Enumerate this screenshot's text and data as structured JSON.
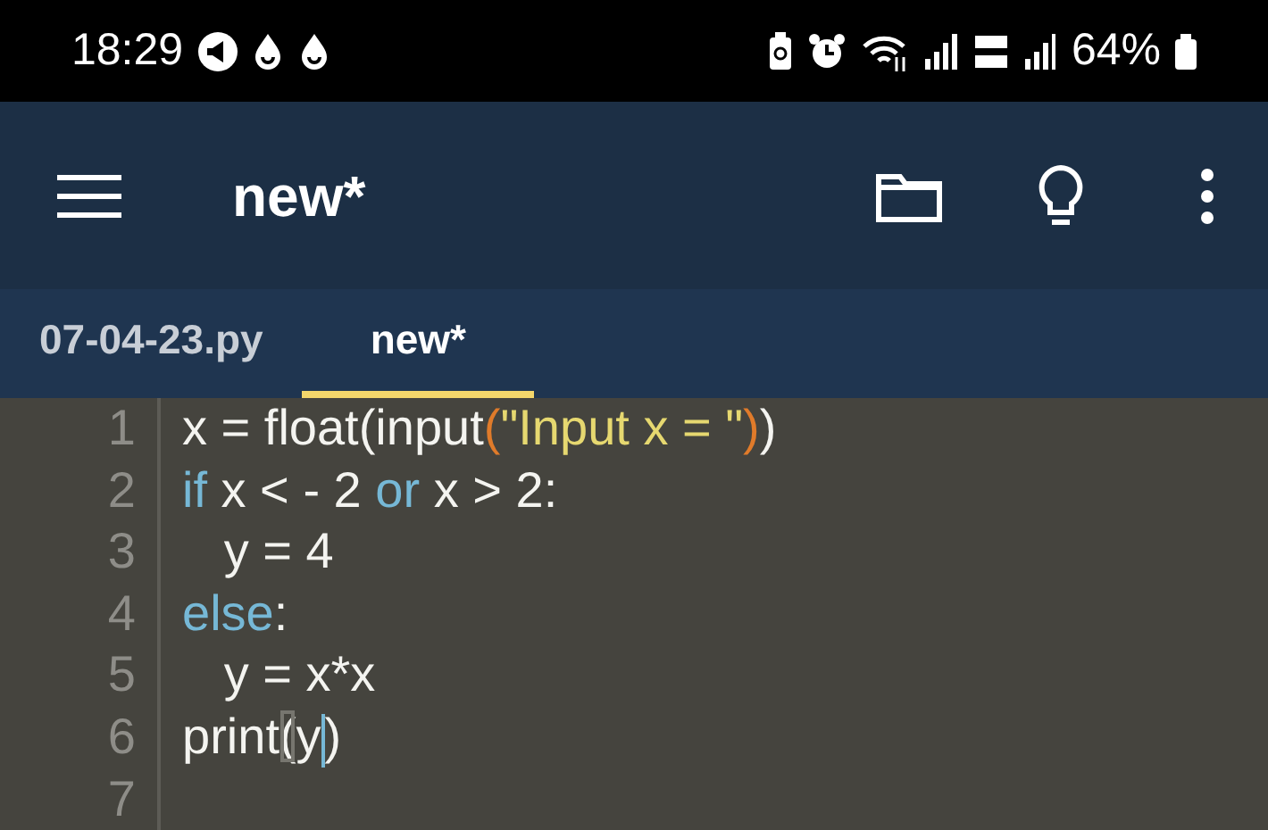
{
  "status_bar": {
    "time": "18:29",
    "battery": "64%"
  },
  "app_bar": {
    "title": "new*"
  },
  "tabs": [
    {
      "label": "07-04-23.py",
      "selected": false
    },
    {
      "label": "new*",
      "selected": true
    }
  ],
  "editor": {
    "lines": [
      {
        "number": "1",
        "tokens": [
          {
            "text": "x = float(input",
            "kind": "plain"
          },
          {
            "text": "(",
            "kind": "paren"
          },
          {
            "text": "\"Input x = \"",
            "kind": "string"
          },
          {
            "text": ")",
            "kind": "paren"
          },
          {
            "text": ")",
            "kind": "plain"
          }
        ]
      },
      {
        "number": "2",
        "tokens": [
          {
            "text": "if",
            "kind": "keyword"
          },
          {
            "text": " x < - 2 ",
            "kind": "plain"
          },
          {
            "text": "or",
            "kind": "keyword"
          },
          {
            "text": " x > 2:",
            "kind": "plain"
          }
        ]
      },
      {
        "number": "3",
        "tokens": [
          {
            "text": "   y = 4",
            "kind": "plain"
          }
        ]
      },
      {
        "number": "4",
        "tokens": [
          {
            "text": "else",
            "kind": "keyword"
          },
          {
            "text": ":",
            "kind": "plain"
          }
        ]
      },
      {
        "number": "5",
        "tokens": [
          {
            "text": "   y = x*x",
            "kind": "plain"
          }
        ]
      },
      {
        "number": "6",
        "tokens": [
          {
            "text": "print",
            "kind": "plain"
          },
          {
            "text": "(",
            "kind": "matched"
          },
          {
            "text": "y",
            "kind": "plain"
          },
          {
            "kind": "caret"
          },
          {
            "text": ")",
            "kind": "plain"
          }
        ]
      },
      {
        "number": "7"
      }
    ]
  }
}
